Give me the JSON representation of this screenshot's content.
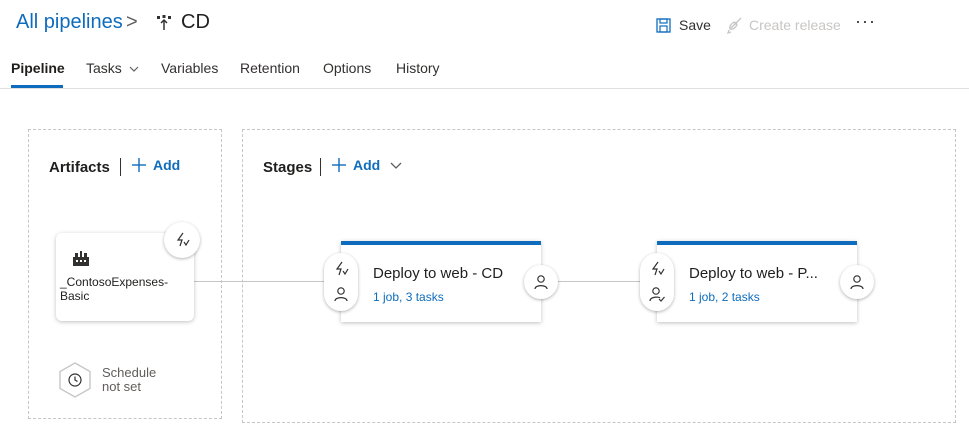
{
  "header": {
    "breadcrumb": "All pipelines",
    "separator": ">",
    "pipeline_name": "CD",
    "save_label": "Save",
    "create_release_label": "Create release",
    "more_label": "···"
  },
  "tabs": [
    {
      "label": "Pipeline",
      "active": true
    },
    {
      "label": "Tasks",
      "has_dropdown": true
    },
    {
      "label": "Variables"
    },
    {
      "label": "Retention"
    },
    {
      "label": "Options"
    },
    {
      "label": "History"
    }
  ],
  "artifacts": {
    "title": "Artifacts",
    "add_label": "Add",
    "items": [
      {
        "name": "_ContosoExpenses-Basic",
        "icon": "build-artifact-icon"
      }
    ],
    "schedule_label": "Schedule not set"
  },
  "stages": {
    "title": "Stages",
    "add_label": "Add",
    "items": [
      {
        "name": "Deploy to web - CD",
        "summary": "1 job, 3 tasks"
      },
      {
        "name": "Deploy to web - P...",
        "summary": "1 job, 2 tasks"
      }
    ]
  },
  "colors": {
    "accent": "#0f6cbd",
    "text": "#201f1e",
    "disabled": "#c8c6c4",
    "border": "#c8c6c4"
  }
}
